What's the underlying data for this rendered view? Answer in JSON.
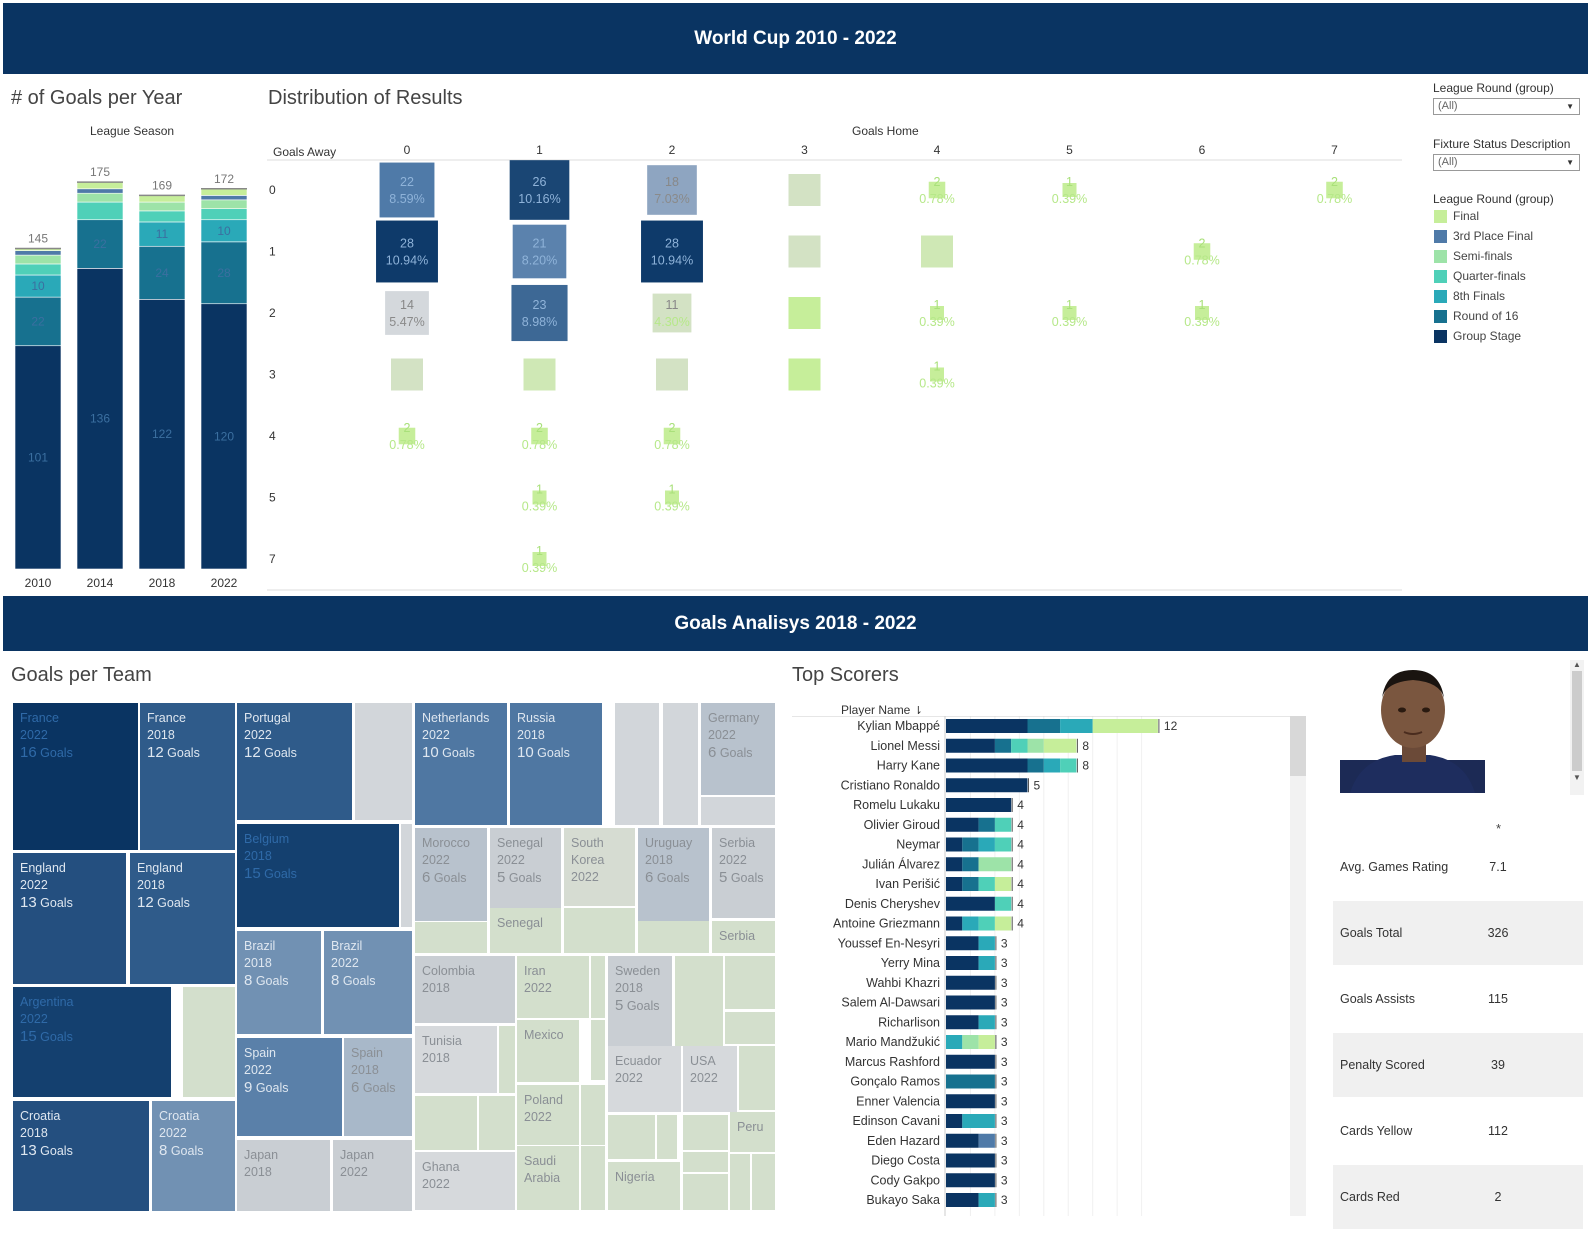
{
  "header": {
    "title": "World Cup 2010 - 2022"
  },
  "header2": {
    "title": "Goals Analisys 2018 - 2022"
  },
  "goals_per_year": {
    "title": "# of Goals per Year",
    "subtitle": "League Season"
  },
  "distribution": {
    "title": "Distribution of Results",
    "col_header": "Goals Home",
    "row_header": "Goals Away"
  },
  "filters": {
    "round_label": "League Round (group)",
    "round_value": "(All)",
    "status_label": "Fixture Status Description",
    "status_value": "(All)",
    "legend_title": "League Round (group)",
    "legend": [
      {
        "name": "Final",
        "color": "#c6ee9a"
      },
      {
        "name": "3rd Place Final",
        "color": "#4f7aa8"
      },
      {
        "name": "Semi-finals",
        "color": "#9de3a8"
      },
      {
        "name": "Quarter-finals",
        "color": "#4fd0b8"
      },
      {
        "name": "8th Finals",
        "color": "#2aa9b8"
      },
      {
        "name": "Round of 16",
        "color": "#17718f"
      },
      {
        "name": "Group Stage",
        "color": "#0a3462"
      }
    ]
  },
  "chart_data": [
    {
      "type": "bar",
      "title": "# of Goals per Year",
      "xlabel": "League Season",
      "categories": [
        "2010",
        "2014",
        "2018",
        "2022"
      ],
      "totals": [
        145,
        175,
        169,
        172
      ],
      "series": [
        {
          "name": "Group Stage",
          "values": [
            101,
            136,
            122,
            120
          ]
        },
        {
          "name": "Round of 16",
          "values": [
            22,
            22,
            24,
            28
          ]
        },
        {
          "name": "8th Finals",
          "values": [
            10,
            0,
            11,
            10
          ]
        },
        {
          "name": "Quarter-finals",
          "values": [
            5,
            8,
            5,
            5
          ]
        },
        {
          "name": "Semi-finals",
          "values": [
            4,
            4,
            4,
            4
          ]
        },
        {
          "name": "3rd Place Final",
          "values": [
            2,
            2,
            0,
            2
          ]
        },
        {
          "name": "Final",
          "values": [
            1,
            3,
            3,
            3
          ]
        }
      ],
      "labelled_values": {
        "2010": {
          "Group Stage": "101",
          "Round of 16": "22",
          "8th Finals": "10"
        },
        "2014": {
          "Group Stage": "136",
          "Round of 16": "22"
        },
        "2018": {
          "Group Stage": "122",
          "Round of 16": "24",
          "8th Finals": "11"
        },
        "2022": {
          "Group Stage": "120",
          "Round of 16": "28",
          "8th Finals": "10"
        }
      }
    },
    {
      "type": "heatmap",
      "title": "Distribution of Results",
      "xlabel": "Goals Home",
      "ylabel": "Goals Away",
      "x": [
        "0",
        "1",
        "2",
        "3",
        "4",
        "5",
        "6",
        "7"
      ],
      "y": [
        "0",
        "1",
        "2",
        "3",
        "4",
        "5",
        "7"
      ],
      "cells": [
        {
          "x": "0",
          "y": "0",
          "count": 22,
          "pct": "8.59%",
          "color": "#4f7aa8"
        },
        {
          "x": "1",
          "y": "0",
          "count": 26,
          "pct": "10.16%",
          "color": "#1a4674"
        },
        {
          "x": "2",
          "y": "0",
          "count": 18,
          "pct": "7.03%",
          "color": "#8ea5c1"
        },
        {
          "x": "3",
          "y": "0",
          "count": null,
          "pct": "",
          "color": "#d3e2c4"
        },
        {
          "x": "4",
          "y": "0",
          "count": 2,
          "pct": "0.78%",
          "color": "#c6ee9a"
        },
        {
          "x": "5",
          "y": "0",
          "count": 1,
          "pct": "0.39%",
          "color": "#c6ee9a"
        },
        {
          "x": "7",
          "y": "0",
          "count": 2,
          "pct": "0.78%",
          "color": "#c6ee9a"
        },
        {
          "x": "0",
          "y": "1",
          "count": 28,
          "pct": "10.94%",
          "color": "#0e3a6a"
        },
        {
          "x": "1",
          "y": "1",
          "count": 21,
          "pct": "8.20%",
          "color": "#5b82ad"
        },
        {
          "x": "2",
          "y": "1",
          "count": 28,
          "pct": "10.94%",
          "color": "#0e3a6a"
        },
        {
          "x": "3",
          "y": "1",
          "count": null,
          "pct": "",
          "color": "#d3e2c4"
        },
        {
          "x": "4",
          "y": "1",
          "count": null,
          "pct": "",
          "color": "#cfe8b5"
        },
        {
          "x": "6",
          "y": "1",
          "count": 2,
          "pct": "0.78%",
          "color": "#c6ee9a"
        },
        {
          "x": "0",
          "y": "2",
          "count": 14,
          "pct": "5.47%",
          "color": "#d4d8dc"
        },
        {
          "x": "1",
          "y": "2",
          "count": 23,
          "pct": "8.98%",
          "color": "#3d6895"
        },
        {
          "x": "2",
          "y": "2",
          "count": 11,
          "pct": "4.30%",
          "color": "#d3e2c4"
        },
        {
          "x": "3",
          "y": "2",
          "count": null,
          "pct": "",
          "color": "#c6ee9a"
        },
        {
          "x": "4",
          "y": "2",
          "count": 1,
          "pct": "0.39%",
          "color": "#c6ee9a"
        },
        {
          "x": "5",
          "y": "2",
          "count": 1,
          "pct": "0.39%",
          "color": "#c6ee9a"
        },
        {
          "x": "6",
          "y": "2",
          "count": 1,
          "pct": "0.39%",
          "color": "#c6ee9a"
        },
        {
          "x": "0",
          "y": "3",
          "count": null,
          "pct": "",
          "color": "#d3e2c4"
        },
        {
          "x": "1",
          "y": "3",
          "count": null,
          "pct": "",
          "color": "#cfe8b5"
        },
        {
          "x": "2",
          "y": "3",
          "count": null,
          "pct": "",
          "color": "#d3e2c4"
        },
        {
          "x": "3",
          "y": "3",
          "count": null,
          "pct": "",
          "color": "#c6ee9a"
        },
        {
          "x": "4",
          "y": "3",
          "count": 1,
          "pct": "0.39%",
          "color": "#c6ee9a"
        },
        {
          "x": "0",
          "y": "4",
          "count": 2,
          "pct": "0.78%",
          "color": "#c6ee9a"
        },
        {
          "x": "1",
          "y": "4",
          "count": 2,
          "pct": "0.78%",
          "color": "#c6ee9a"
        },
        {
          "x": "2",
          "y": "4",
          "count": 2,
          "pct": "0.78%",
          "color": "#c6ee9a"
        },
        {
          "x": "1",
          "y": "5",
          "count": 1,
          "pct": "0.39%",
          "color": "#c6ee9a"
        },
        {
          "x": "2",
          "y": "5",
          "count": 1,
          "pct": "0.39%",
          "color": "#c6ee9a"
        },
        {
          "x": "1",
          "y": "7",
          "count": 1,
          "pct": "0.39%",
          "color": "#c6ee9a"
        }
      ]
    },
    {
      "type": "bar",
      "title": "Top Scorers",
      "ylabel": "Player Name",
      "categories": [
        "Kylian Mbappé",
        "Lionel Messi",
        "Harry Kane",
        "Cristiano Ronaldo",
        "Romelu Lukaku",
        "Olivier Giroud",
        "Neymar",
        "Julián Álvarez",
        "Ivan Perišić",
        "Denis Cheryshev",
        "Antoine Griezmann",
        "Youssef En-Nesyri",
        "Yerry Mina",
        "Wahbi Khazri",
        "Salem Al-Dawsari",
        "Richarlison",
        "Mario Mandžukić",
        "Marcus Rashford",
        "Gonçalo Ramos",
        "Enner Valencia",
        "Edinson Cavani",
        "Eden Hazard",
        "Diego Costa",
        "Cody Gakpo",
        "Bukayo Saka"
      ],
      "totals": [
        12,
        8,
        8,
        5,
        4,
        4,
        4,
        4,
        4,
        4,
        4,
        3,
        3,
        3,
        3,
        3,
        3,
        3,
        3,
        3,
        3,
        3,
        3,
        3,
        3
      ],
      "segments": [
        [
          [
            "Group Stage",
            5
          ],
          [
            "Round of 16",
            2
          ],
          [
            "8th Finals",
            2
          ],
          [
            "Final",
            4
          ]
        ],
        [
          [
            "Group Stage",
            3
          ],
          [
            "Round of 16",
            1
          ],
          [
            "Quarter-finals",
            1
          ],
          [
            "Semi-finals",
            1
          ],
          [
            "Final",
            2
          ]
        ],
        [
          [
            "Group Stage",
            5
          ],
          [
            "Round of 16",
            1
          ],
          [
            "8th Finals",
            1
          ],
          [
            "Quarter-finals",
            1
          ]
        ],
        [
          [
            "Group Stage",
            5
          ]
        ],
        [
          [
            "Group Stage",
            4
          ]
        ],
        [
          [
            "Group Stage",
            2
          ],
          [
            "Round of 16",
            1
          ],
          [
            "Quarter-finals",
            1
          ]
        ],
        [
          [
            "Group Stage",
            1
          ],
          [
            "Round of 16",
            1
          ],
          [
            "8th Finals",
            1
          ],
          [
            "Quarter-finals",
            1
          ]
        ],
        [
          [
            "Group Stage",
            1
          ],
          [
            "Round of 16",
            1
          ],
          [
            "Semi-finals",
            2
          ]
        ],
        [
          [
            "Group Stage",
            1
          ],
          [
            "Round of 16",
            1
          ],
          [
            "Quarter-finals",
            1
          ],
          [
            "Final",
            1
          ]
        ],
        [
          [
            "Group Stage",
            3
          ],
          [
            "Quarter-finals",
            1
          ]
        ],
        [
          [
            "Group Stage",
            1
          ],
          [
            "8th Finals",
            1
          ],
          [
            "Quarter-finals",
            1
          ],
          [
            "Final",
            1
          ]
        ],
        [
          [
            "Group Stage",
            2
          ],
          [
            "8th Finals",
            1
          ]
        ],
        [
          [
            "Group Stage",
            2
          ],
          [
            "8th Finals",
            1
          ]
        ],
        [
          [
            "Group Stage",
            3
          ]
        ],
        [
          [
            "Group Stage",
            3
          ]
        ],
        [
          [
            "Group Stage",
            2
          ],
          [
            "8th Finals",
            1
          ]
        ],
        [
          [
            "8th Finals",
            1
          ],
          [
            "Semi-finals",
            1
          ],
          [
            "Final",
            1
          ]
        ],
        [
          [
            "Group Stage",
            3
          ]
        ],
        [
          [
            "Round of 16",
            3
          ]
        ],
        [
          [
            "Group Stage",
            3
          ]
        ],
        [
          [
            "Group Stage",
            1
          ],
          [
            "8th Finals",
            2
          ]
        ],
        [
          [
            "Group Stage",
            2
          ],
          [
            "3rd Place Final",
            1
          ]
        ],
        [
          [
            "Group Stage",
            3
          ]
        ],
        [
          [
            "Group Stage",
            3
          ]
        ],
        [
          [
            "Group Stage",
            2
          ],
          [
            "8th Finals",
            1
          ]
        ]
      ],
      "xlim": [
        0,
        14
      ]
    }
  ],
  "goals_per_team": {
    "title": "Goals per Team",
    "tiles": [
      {
        "team": "France",
        "year": "2022",
        "goals": "16",
        "unit": "Goals",
        "color": "#0a3462"
      },
      {
        "team": "France",
        "year": "2018",
        "goals": "12",
        "unit": "Goals",
        "color": "#2f5b8a"
      },
      {
        "team": "England",
        "year": "2022",
        "goals": "13",
        "unit": "Goals",
        "color": "#244f7f"
      },
      {
        "team": "England",
        "year": "2018",
        "goals": "12",
        "unit": "Goals",
        "color": "#2f5b8a"
      },
      {
        "team": "Argentina",
        "year": "2022",
        "goals": "15",
        "unit": "Goals",
        "color": "#14406f"
      },
      {
        "team": "Croatia",
        "year": "2018",
        "goals": "13",
        "unit": "Goals",
        "color": "#244f7f"
      },
      {
        "team": "Croatia",
        "year": "2022",
        "goals": "8",
        "unit": "Goals",
        "color": "#7191b3"
      },
      {
        "team": "Portugal",
        "year": "2022",
        "goals": "12",
        "unit": "Goals",
        "color": "#2f5b8a"
      },
      {
        "team": "Belgium",
        "year": "2018",
        "goals": "15",
        "unit": "Goals",
        "color": "#14406f"
      },
      {
        "team": "Brazil",
        "year": "2018",
        "goals": "8",
        "unit": "Goals",
        "color": "#7191b3"
      },
      {
        "team": "Brazil",
        "year": "2022",
        "goals": "8",
        "unit": "Goals",
        "color": "#7191b3"
      },
      {
        "team": "Spain",
        "year": "2022",
        "goals": "9",
        "unit": "Goals",
        "color": "#5a80a9"
      },
      {
        "team": "Spain",
        "year": "2018",
        "goals": "6",
        "unit": "Goals",
        "color": "#a8b8c9"
      },
      {
        "team": "Japan",
        "year": "2018",
        "goals": "",
        "unit": "",
        "color": "#c9ced3"
      },
      {
        "team": "Japan",
        "year": "2022",
        "goals": "",
        "unit": "",
        "color": "#c9ced3"
      },
      {
        "team": "Netherlands",
        "year": "2022",
        "goals": "10",
        "unit": "Goals",
        "color": "#4f77a2"
      },
      {
        "team": "Russia",
        "year": "2018",
        "goals": "10",
        "unit": "Goals",
        "color": "#4f77a2"
      },
      {
        "team": "Germany",
        "year": "2022",
        "goals": "6",
        "unit": "Goals",
        "color": "#b8c2cd"
      },
      {
        "team": "Morocco",
        "year": "2022",
        "goals": "6",
        "unit": "Goals",
        "color": "#b8c2cd"
      },
      {
        "team": "Senegal",
        "year": "2022",
        "goals": "5",
        "unit": "Goals",
        "color": "#c9ced3"
      },
      {
        "team": "South Korea",
        "year": "2022",
        "goals": "",
        "unit": "",
        "color": "#d6dcd2"
      },
      {
        "team": "Uruguay",
        "year": "2018",
        "goals": "6",
        "unit": "Goals",
        "color": "#b8c2cd"
      },
      {
        "team": "Serbia",
        "year": "2022",
        "goals": "5",
        "unit": "Goals",
        "color": "#c9ced3"
      },
      {
        "team": "Senegal",
        "year": "",
        "goals": "",
        "unit": "",
        "color": "#d3dfcc"
      },
      {
        "team": "Serbia",
        "year": "",
        "goals": "",
        "unit": "",
        "color": "#d3dfcc"
      },
      {
        "team": "Colombia",
        "year": "2018",
        "goals": "",
        "unit": "",
        "color": "#c9ced3"
      },
      {
        "team": "Iran",
        "year": "2022",
        "goals": "",
        "unit": "",
        "color": "#d3dfcc"
      },
      {
        "team": "Sweden",
        "year": "2018",
        "goals": "5",
        "unit": "Goals",
        "color": "#c9ced3"
      },
      {
        "team": "Tunisia",
        "year": "2018",
        "goals": "",
        "unit": "",
        "color": "#d6d9dc"
      },
      {
        "team": "Mexico",
        "year": "",
        "goals": "",
        "unit": "",
        "color": "#d3dfcc"
      },
      {
        "team": "Ecuador",
        "year": "2022",
        "goals": "",
        "unit": "",
        "color": "#d6d9dc"
      },
      {
        "team": "USA",
        "year": "2022",
        "goals": "",
        "unit": "",
        "color": "#d6d9dc"
      },
      {
        "team": "Poland",
        "year": "2022",
        "goals": "",
        "unit": "",
        "color": "#d3dfcc"
      },
      {
        "team": "Peru",
        "year": "",
        "goals": "",
        "unit": "",
        "color": "#d3dfcc"
      },
      {
        "team": "Ghana",
        "year": "2022",
        "goals": "",
        "unit": "",
        "color": "#d6d9dc"
      },
      {
        "team": "Saudi Arabia",
        "year": "",
        "goals": "",
        "unit": "",
        "color": "#d3dfcc"
      },
      {
        "team": "Nigeria",
        "year": "",
        "goals": "",
        "unit": "",
        "color": "#d3dfcc"
      }
    ]
  },
  "top_scorers": {
    "title": "Top Scorers",
    "column_label": "Player Name"
  },
  "player_stats": {
    "header_mark": "*",
    "rows": [
      {
        "label": "Avg. Games Rating",
        "value": "7.1"
      },
      {
        "label": "Goals Total",
        "value": "326"
      },
      {
        "label": "Goals Assists",
        "value": "115"
      },
      {
        "label": "Penalty Scored",
        "value": "39"
      },
      {
        "label": "Cards Yellow",
        "value": "112"
      },
      {
        "label": "Cards Red",
        "value": "2"
      }
    ]
  }
}
